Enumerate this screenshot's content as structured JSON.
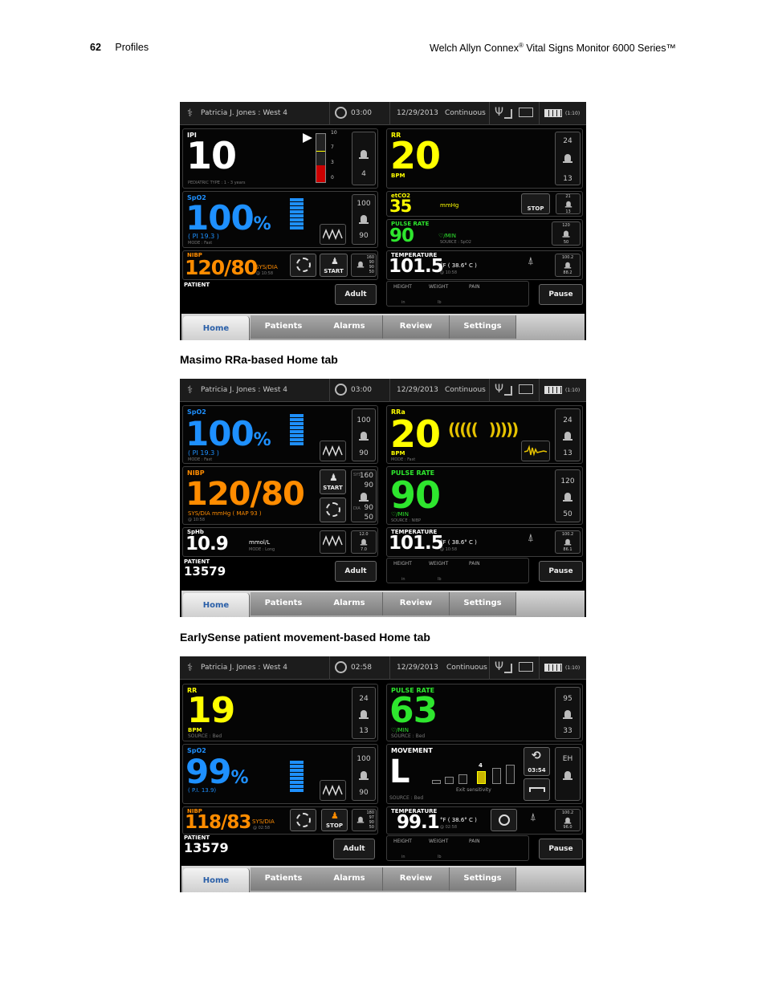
{
  "header": {
    "page_number": "62",
    "section": "Profiles",
    "title": "Welch Allyn Connex",
    "reg": "®",
    "title_rest": " Vital Signs Monitor 6000 Series™"
  },
  "captions": [
    "Masimo RRa-based Home tab",
    "EarlySense patient movement-based Home tab"
  ],
  "topbar": {
    "patient": "Patricia J. Jones : West 4",
    "date": "12/29/2013",
    "mode": "Continuous",
    "battery": "(1:10)"
  },
  "tabs": [
    "Home",
    "Patients",
    "Alarms",
    "Review",
    "Settings"
  ],
  "common": {
    "adult": "Adult",
    "pause": "Pause",
    "height": "HEIGHT",
    "weight": "WEIGHT",
    "pain": "PAIN",
    "in": "in",
    "lb": "lb",
    "start": "START",
    "stop": "STOP",
    "temp_unit": "°F ( 38.6° C )",
    "sys": "SYS",
    "dia": "DIA"
  },
  "s1": {
    "time": "03:00",
    "ipi": {
      "label": "IPI",
      "value": "10",
      "scale": [
        "10",
        "7",
        "3",
        "0"
      ],
      "alarm": "4",
      "mode": "PEDIATRIC TYPE : 1 - 3 years"
    },
    "rr": {
      "label": "RR",
      "value": "20",
      "unit": "BPM",
      "hi": "24",
      "lo": "13"
    },
    "spo2": {
      "label": "SpO2",
      "value": "100",
      "pct": "%",
      "pi": "( PI 19.3 )",
      "mode": "MODE : Fast",
      "hi": "100",
      "lo": "90"
    },
    "etco2": {
      "label": "etCO2",
      "value": "35",
      "unit": "mmHg",
      "stop": "STOP",
      "hi": "21",
      "lo": "13"
    },
    "pulse": {
      "label": "PULSE RATE",
      "value": "90",
      "unit": "♡/MIN",
      "source": "SOURCE : SpO2",
      "hi": "120",
      "lo": "50"
    },
    "nibp": {
      "label": "NIBP",
      "value": "120/80",
      "unit": "SYS/DIA",
      "time": "@ 10:58",
      "hi1": "160",
      "hi2": "90",
      "lo1": "90",
      "lo2": "50"
    },
    "temp": {
      "label": "TEMPERATURE",
      "value": "101.5",
      "time": "@ 10:58",
      "hi": "100.2",
      "lo": "88.2"
    },
    "patient": {
      "label": "PATIENT",
      "id": ""
    }
  },
  "s2": {
    "time": "03:00",
    "spo2": {
      "label": "SpO2",
      "value": "100",
      "pct": "%",
      "pi": "( PI 19.3 )",
      "mode": "MODE : Fast",
      "hi": "100",
      "lo": "90"
    },
    "rra": {
      "label": "RRa",
      "value": "20",
      "unit": "BPM",
      "mode": "MODE : Fast",
      "hi": "24",
      "lo": "13"
    },
    "nibp": {
      "label": "NIBP",
      "value": "120/80",
      "unit": "SYS/DIA  mmHg  ( MAP 93 )",
      "time": "@ 10:58",
      "s_hi": "160",
      "s_lo": "90",
      "d_hi": "90",
      "d_lo": "50"
    },
    "pulse": {
      "label": "PULSE RATE",
      "value": "90",
      "unit": "♡/MIN",
      "source": "SOURCE : NIBP",
      "hi": "120",
      "lo": "50"
    },
    "sphb": {
      "label": "SpHb",
      "value": "10.9",
      "unit": "mmol/L",
      "mode": "MODE : Long",
      "hi": "12.0",
      "lo": "7.0"
    },
    "temp": {
      "label": "TEMPERATURE",
      "value": "101.5",
      "time": "@ 10:58",
      "hi": "100.2",
      "lo": "86.1"
    },
    "patient": {
      "label": "PATIENT",
      "id": "13579"
    }
  },
  "s3": {
    "time": "02:58",
    "rr": {
      "label": "RR",
      "value": "19",
      "unit": "BPM",
      "source": "SOURCE : Bed",
      "hi": "24",
      "lo": "13"
    },
    "pulse": {
      "label": "PULSE RATE",
      "value": "63",
      "unit": "♡/MIN",
      "source": "SOURCE : Bed",
      "hi": "95",
      "lo": "33"
    },
    "spo2": {
      "label": "SpO2",
      "value": "99",
      "pct": "%",
      "pi": "( P.I. 13.9)",
      "hi": "100",
      "lo": "90"
    },
    "movement": {
      "label": "MOVEMENT",
      "value": "L",
      "level": "4",
      "sens": "Exit sensitivity",
      "source": "SOURCE : Bed",
      "timer": "03:54",
      "eh": "EH"
    },
    "nibp": {
      "label": "NIBP",
      "value": "118/83",
      "unit": "SYS/DIA",
      "time": "@ 02:58",
      "hi1": "180",
      "hi2": "97",
      "lo1": "90",
      "lo2": "50"
    },
    "temp": {
      "label": "TEMPERATURE",
      "value": "99.1",
      "time": "@ 02:58",
      "hi": "100.2",
      "lo": "96.0"
    },
    "patient": {
      "label": "PATIENT",
      "id": "13579"
    }
  }
}
